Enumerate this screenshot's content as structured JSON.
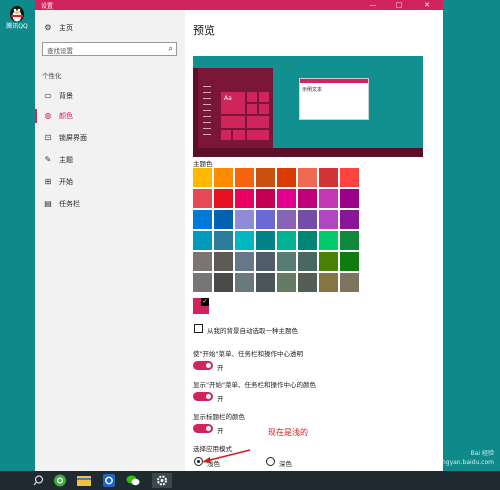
{
  "desktop": {
    "shortcut_label": "腾讯QQ",
    "icon": "penguin-icon"
  },
  "window": {
    "title": "设置",
    "accent": "#d0245c",
    "controls": [
      "—",
      "□",
      "✕"
    ]
  },
  "sidebar": {
    "home": "主页",
    "search_placeholder": "查找设置",
    "category": "个性化",
    "items": [
      {
        "label": "背景",
        "icon": "image-icon",
        "selected": false
      },
      {
        "label": "颜色",
        "icon": "palette-icon",
        "selected": true
      },
      {
        "label": "锁屏界面",
        "icon": "lock-screen-icon",
        "selected": false
      },
      {
        "label": "主题",
        "icon": "theme-icon",
        "selected": false
      },
      {
        "label": "开始",
        "icon": "start-icon",
        "selected": false
      },
      {
        "label": "任务栏",
        "icon": "taskbar-icon",
        "selected": false
      }
    ]
  },
  "main": {
    "heading": "预览",
    "preview": {
      "sample_tile": "Aa",
      "sample_text": "示例文本"
    },
    "colors_label": "主题色",
    "swatches": [
      [
        "#ffb900",
        "#ff8c00",
        "#f7630c",
        "#ca5010",
        "#da3b01",
        "#ef6950",
        "#d13438",
        "#ff4343"
      ],
      [
        "#e74856",
        "#e81123",
        "#ea005e",
        "#c30052",
        "#e3008c",
        "#bf0077",
        "#c239b3",
        "#9a0089"
      ],
      [
        "#0078d7",
        "#0063b1",
        "#8e8cd8",
        "#6b69d6",
        "#8764b8",
        "#744da9",
        "#b146c2",
        "#881798"
      ],
      [
        "#0099bc",
        "#2d7d9a",
        "#00b7c3",
        "#038387",
        "#00b294",
        "#018574",
        "#00cc6a",
        "#10893e"
      ],
      [
        "#7a7574",
        "#5d5a58",
        "#68768a",
        "#515c6b",
        "#567c73",
        "#486860",
        "#498205",
        "#107c10"
      ],
      [
        "#767676",
        "#4c4a48",
        "#69797e",
        "#4a5459",
        "#647c64",
        "#525e54",
        "#847545",
        "#7e735f"
      ]
    ],
    "custom_color": "#d0245c",
    "auto_pick_label": "从我的背景自动选取一种主题色",
    "toggles": [
      {
        "label": "使\"开始\"菜单、任务栏和操作中心透明",
        "state": "开"
      },
      {
        "label": "显示\"开始\"菜单、任务栏和操作中心的颜色",
        "state": "开"
      },
      {
        "label": "显示标题栏的颜色",
        "state": "开"
      }
    ],
    "app_mode": {
      "label": "选择应用模式",
      "options": [
        "浅色",
        "深色"
      ],
      "selected": "浅色"
    },
    "annotation": "现在是浅的"
  },
  "taskbar": {
    "icons": [
      "search-icon",
      "browser-icon",
      "file-explorer-icon",
      "qq-browser-icon",
      "wechat-icon",
      "settings-icon"
    ]
  },
  "watermark": {
    "line1": "Bai 经验",
    "line2": "jingyan.baidu.com"
  }
}
